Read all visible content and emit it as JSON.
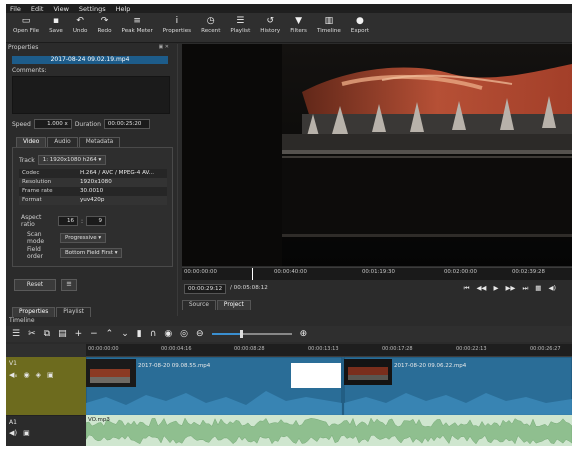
{
  "menu": [
    "File",
    "Edit",
    "View",
    "Settings",
    "Help"
  ],
  "toolbar": [
    {
      "label": "Open File",
      "icon": "open-file-icon",
      "glyph": "▭"
    },
    {
      "label": "Save",
      "icon": "save-icon",
      "glyph": "▪"
    },
    {
      "label": "Undo",
      "icon": "undo-icon",
      "glyph": "↶"
    },
    {
      "label": "Redo",
      "icon": "redo-icon",
      "glyph": "↷"
    },
    {
      "label": "Peak Meter",
      "icon": "peak-meter-icon",
      "glyph": "≡"
    },
    {
      "label": "Properties",
      "icon": "info-icon",
      "glyph": "i"
    },
    {
      "label": "Recent",
      "icon": "clock-icon",
      "glyph": "◷"
    },
    {
      "label": "Playlist",
      "icon": "playlist-icon",
      "glyph": "☰"
    },
    {
      "label": "History",
      "icon": "history-icon",
      "glyph": "↺"
    },
    {
      "label": "Filters",
      "icon": "filter-icon",
      "glyph": "▼"
    },
    {
      "label": "Timeline",
      "icon": "timeline-icon",
      "glyph": "▥"
    },
    {
      "label": "Export",
      "icon": "export-icon",
      "glyph": "●"
    }
  ],
  "properties": {
    "title": "Properties",
    "filename": "2017-08-24 09.02.19.mp4",
    "comments_label": "Comments:",
    "speed_label": "Speed",
    "speed_value": "1.000 x",
    "duration_label": "Duration",
    "duration_value": "00:00:25:20",
    "tabs": [
      "Video",
      "Audio",
      "Metadata"
    ],
    "track_label": "Track",
    "track_value": "1: 1920x1080 h264",
    "rows": [
      {
        "k": "Codec",
        "v": "H.264 / AVC / MPEG-4 AV..."
      },
      {
        "k": "Resolution",
        "v": "1920x1080"
      },
      {
        "k": "Frame rate",
        "v": "30.0010"
      },
      {
        "k": "Format",
        "v": "yuv420p"
      }
    ],
    "aspect_label": "Aspect ratio",
    "aspect_w": "16",
    "aspect_h": "9",
    "scan_label": "Scan mode",
    "scan_value": "Progressive",
    "field_label": "Field order",
    "field_value": "Bottom Field First",
    "reset_label": "Reset",
    "bottom_tabs": [
      "Properties",
      "Playlist"
    ]
  },
  "player": {
    "ruler_labels": [
      "00:00:00:00",
      "00:00:40:00",
      "00:01:19:30",
      "00:02:00:00",
      "00:02:39:28"
    ],
    "current_time": "00:00:29:12",
    "total_time": "/ 00:05:08:12",
    "source_tabs": [
      "Source",
      "Project"
    ],
    "playhead_fraction": 0.18
  },
  "timeline": {
    "title": "Timeline",
    "ruler_labels": [
      "00:00:00:00",
      "00:00:04:16",
      "00:00:08:28",
      "00:00:13:13",
      "00:00:17:28",
      "00:00:22:13",
      "00:00:26:27"
    ],
    "video_track": "V1",
    "audio_track": "A1",
    "clip1": "2017-08-20 09.08.55.mp4",
    "clip2": "2017-08-20 09.06.22.mp4",
    "audio_clip": "VO.mp3",
    "tools": [
      {
        "icon": "menu-icon",
        "glyph": "☰"
      },
      {
        "icon": "cut-icon",
        "glyph": "✂"
      },
      {
        "icon": "copy-icon",
        "glyph": "⧉"
      },
      {
        "icon": "paste-icon",
        "glyph": "▤"
      },
      {
        "icon": "append-icon",
        "glyph": "+"
      },
      {
        "icon": "remove-icon",
        "glyph": "−"
      },
      {
        "icon": "lift-icon",
        "glyph": "⌃"
      },
      {
        "icon": "overwrite-icon",
        "glyph": "⌄"
      },
      {
        "icon": "split-icon",
        "glyph": "▮"
      },
      {
        "icon": "snap-icon",
        "glyph": "∩"
      },
      {
        "icon": "scrub-icon",
        "glyph": "◉"
      },
      {
        "icon": "ripple-icon",
        "glyph": "◎"
      },
      {
        "icon": "zoom-out-icon",
        "glyph": "⊖"
      },
      {
        "icon": "zoom-in-icon",
        "glyph": "⊕"
      }
    ],
    "zoom_fraction": 0.35
  },
  "colors": {
    "accent": "#1d5c8a",
    "video_track": "#2a6d97",
    "audio_track": "#cfe6cf",
    "track_head": "#6d6b1e"
  }
}
